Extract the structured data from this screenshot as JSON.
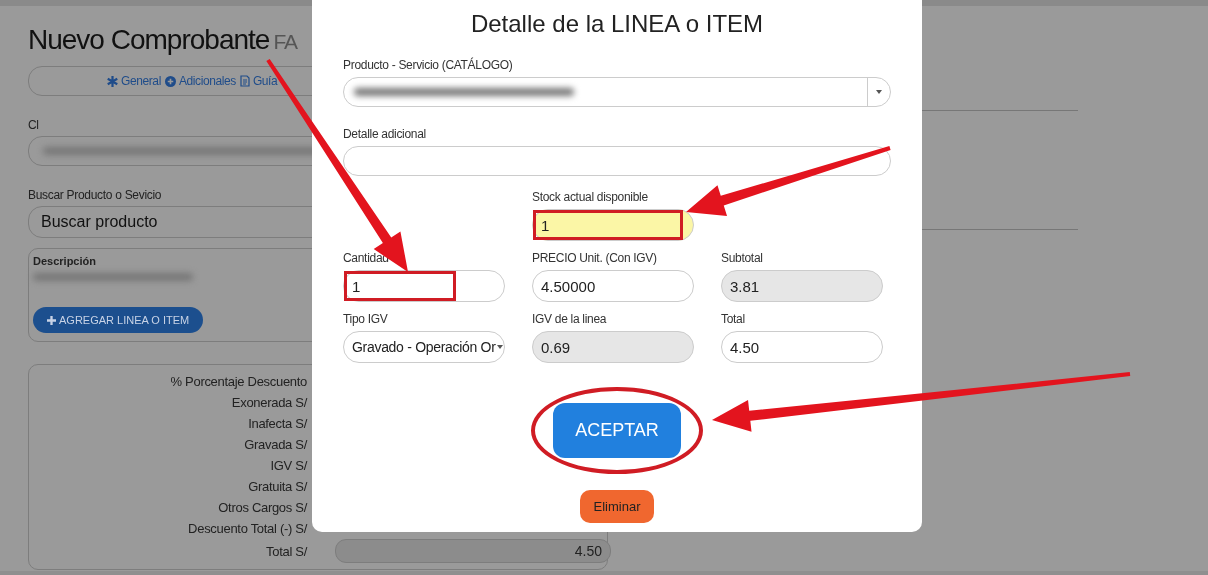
{
  "page": {
    "title": "Nuevo Comprobante",
    "title_suffix": "FA",
    "tabs": [
      {
        "label": "General"
      },
      {
        "label": "Adicionales"
      },
      {
        "label": "Guía"
      }
    ],
    "client": {
      "label": "Cl"
    },
    "search": {
      "label": "Buscar Producto o Sevicio",
      "value": "Buscar producto"
    },
    "description": {
      "label": "Descripción"
    },
    "add_button": "AGREGAR LINEA O ITEM",
    "summary": [
      {
        "label": "% Porcentaje Descuento"
      },
      {
        "label": "Exonerada S/"
      },
      {
        "label": "Inafecta S/"
      },
      {
        "label": "Gravada S/"
      },
      {
        "label": "IGV S/"
      },
      {
        "label": "Gratuita S/"
      },
      {
        "label": "Otros Cargos S/"
      },
      {
        "label": "Descuento Total (-) S/"
      },
      {
        "label": "Total S/",
        "value": "4.50"
      }
    ]
  },
  "modal": {
    "title": "Detalle de la LINEA o ITEM",
    "product": {
      "label": "Producto - Servicio (CATÁLOGO)"
    },
    "detail": {
      "label": "Detalle adicional"
    },
    "stock": {
      "label": "Stock actual disponible",
      "value": "1",
      "highlighted": true
    },
    "fields": [
      {
        "label": "Cantidad",
        "value": "1",
        "kind": "input",
        "highlighted": true
      },
      {
        "label": "PRECIO Unit. (Con IGV)",
        "value": "4.50000",
        "kind": "input",
        "highlighted": false
      },
      {
        "label": "Subtotal",
        "value": "3.81",
        "kind": "readonly",
        "highlighted": false
      },
      {
        "label": "Tipo IGV",
        "value": "Gravado - Operación Or",
        "kind": "select",
        "highlighted": false
      },
      {
        "label": "IGV de la linea",
        "value": "0.69",
        "kind": "readonly",
        "highlighted": false
      },
      {
        "label": "Total",
        "value": "4.50",
        "kind": "input",
        "highlighted": false
      }
    ],
    "buttons": [
      {
        "label": "ACEPTAR",
        "kind": "primary",
        "circled": true
      },
      {
        "label": "Eliminar",
        "kind": "danger",
        "circled": false
      }
    ]
  }
}
